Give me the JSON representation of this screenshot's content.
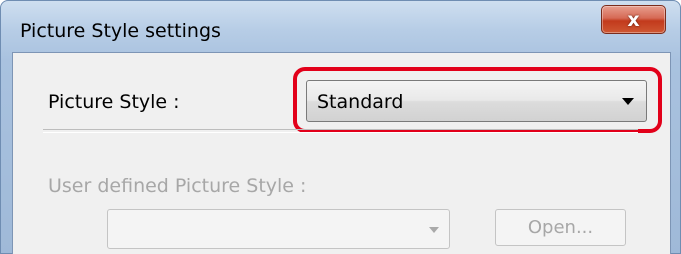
{
  "window": {
    "title": "Picture Style settings",
    "close_glyph": "x"
  },
  "picture_style": {
    "label": "Picture Style :",
    "selected": "Standard"
  },
  "user_defined": {
    "label": "User defined Picture Style :",
    "selected": "",
    "open_label": "Open..."
  },
  "colors": {
    "highlight": "#e2001a",
    "disabled_text": "#a7a7a7",
    "close_button": "#c23a1c"
  }
}
